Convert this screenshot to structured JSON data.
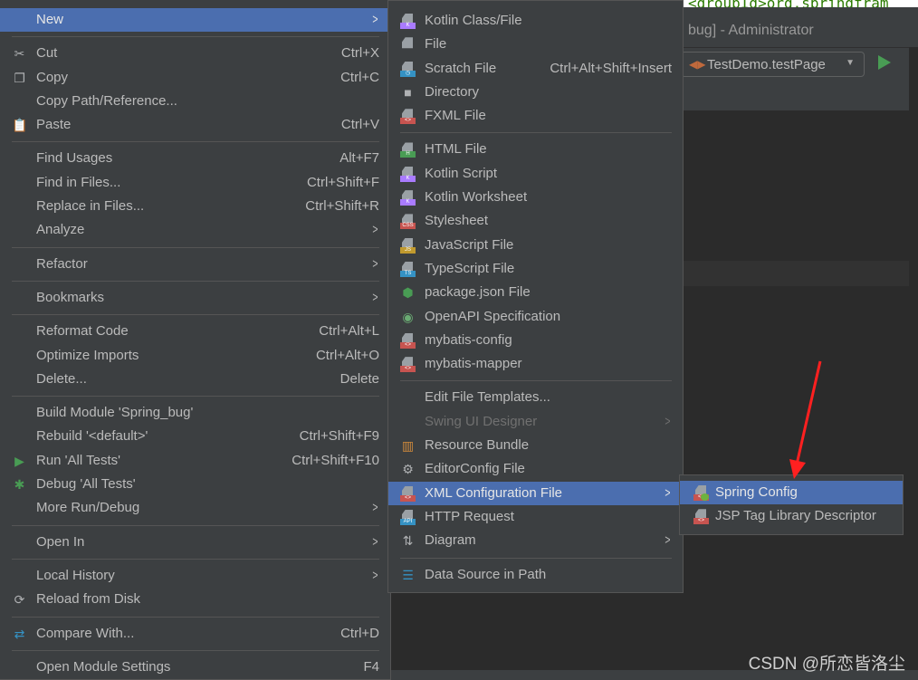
{
  "background": {
    "code_text": "<groupId>org.springfram",
    "window_title": "bug] - Administrator",
    "run_config": "TestDemo.testPage"
  },
  "context_menu": [
    {
      "label": "New",
      "submenu": true,
      "selected": true
    },
    {
      "sep": true
    },
    {
      "label": "Cut",
      "shortcut": "Ctrl+X",
      "icon": "scissors-icon"
    },
    {
      "label": "Copy",
      "shortcut": "Ctrl+C",
      "icon": "copy-icon"
    },
    {
      "label": "Copy Path/Reference..."
    },
    {
      "label": "Paste",
      "shortcut": "Ctrl+V",
      "icon": "clipboard-icon"
    },
    {
      "sep": true
    },
    {
      "label": "Find Usages",
      "shortcut": "Alt+F7"
    },
    {
      "label": "Find in Files...",
      "shortcut": "Ctrl+Shift+F"
    },
    {
      "label": "Replace in Files...",
      "shortcut": "Ctrl+Shift+R"
    },
    {
      "label": "Analyze",
      "submenu": true
    },
    {
      "sep": true
    },
    {
      "label": "Refactor",
      "submenu": true
    },
    {
      "sep": true
    },
    {
      "label": "Bookmarks",
      "submenu": true
    },
    {
      "sep": true
    },
    {
      "label": "Reformat Code",
      "shortcut": "Ctrl+Alt+L"
    },
    {
      "label": "Optimize Imports",
      "shortcut": "Ctrl+Alt+O"
    },
    {
      "label": "Delete...",
      "shortcut": "Delete"
    },
    {
      "sep": true
    },
    {
      "label": "Build Module 'Spring_bug'"
    },
    {
      "label": "Rebuild '<default>'",
      "shortcut": "Ctrl+Shift+F9"
    },
    {
      "label": "Run 'All Tests'",
      "shortcut": "Ctrl+Shift+F10",
      "icon": "run-icon"
    },
    {
      "label": "Debug 'All Tests'",
      "icon": "debug-icon"
    },
    {
      "label": "More Run/Debug",
      "submenu": true
    },
    {
      "sep": true
    },
    {
      "label": "Open In",
      "submenu": true
    },
    {
      "sep": true
    },
    {
      "label": "Local History",
      "submenu": true
    },
    {
      "label": "Reload from Disk",
      "icon": "reload-icon"
    },
    {
      "sep": true
    },
    {
      "label": "Compare With...",
      "shortcut": "Ctrl+D",
      "icon": "compare-icon"
    },
    {
      "sep": true
    },
    {
      "label": "Open Module Settings",
      "shortcut": "F4"
    }
  ],
  "new_menu": [
    {
      "label": "Kotlin Class/File",
      "icon": "kotlin-file-icon",
      "badge": "K",
      "color": "#a97bff"
    },
    {
      "label": "File",
      "icon": "file-icon"
    },
    {
      "label": "Scratch File",
      "shortcut": "Ctrl+Alt+Shift+Insert",
      "icon": "scratch-file-icon",
      "badge": "◷",
      "color": "#3592c4"
    },
    {
      "label": "Directory",
      "icon": "folder-icon"
    },
    {
      "label": "FXML File",
      "icon": "fxml-file-icon",
      "badge": "<>",
      "color": "#c75450"
    },
    {
      "sep": true
    },
    {
      "label": "HTML File",
      "icon": "html-file-icon",
      "badge": "H",
      "color": "#499c54"
    },
    {
      "label": "Kotlin Script",
      "icon": "kotlin-script-icon",
      "badge": "K",
      "color": "#a97bff"
    },
    {
      "label": "Kotlin Worksheet",
      "icon": "kotlin-worksheet-icon",
      "badge": "K",
      "color": "#a97bff"
    },
    {
      "label": "Stylesheet",
      "icon": "css-file-icon",
      "badge": "CSS",
      "color": "#c75450"
    },
    {
      "label": "JavaScript File",
      "icon": "js-file-icon",
      "badge": "JS",
      "color": "#c19a2e"
    },
    {
      "label": "TypeScript File",
      "icon": "ts-file-icon",
      "badge": "TS",
      "color": "#3592c4"
    },
    {
      "label": "package.json File",
      "icon": "nodejs-icon"
    },
    {
      "label": "OpenAPI Specification",
      "icon": "openapi-icon"
    },
    {
      "label": "mybatis-config",
      "icon": "xml-file-icon",
      "badge": "<>",
      "color": "#c75450"
    },
    {
      "label": "mybatis-mapper",
      "icon": "xml-file-icon",
      "badge": "<>",
      "color": "#c75450"
    },
    {
      "sep": true
    },
    {
      "label": "Edit File Templates..."
    },
    {
      "label": "Swing UI Designer",
      "submenu": true,
      "disabled": true
    },
    {
      "label": "Resource Bundle",
      "icon": "resource-bundle-icon"
    },
    {
      "label": "EditorConfig File",
      "icon": "gear-icon"
    },
    {
      "label": "XML Configuration File",
      "submenu": true,
      "selected": true,
      "icon": "xml-file-icon",
      "badge": "<>",
      "color": "#c75450"
    },
    {
      "label": "HTTP Request",
      "icon": "http-request-icon",
      "badge": "API",
      "color": "#3592c4"
    },
    {
      "label": "Diagram",
      "submenu": true,
      "icon": "diagram-icon"
    },
    {
      "sep": true
    },
    {
      "label": "Data Source in Path",
      "icon": "database-icon"
    }
  ],
  "xml_menu": [
    {
      "label": "Spring Config",
      "selected": true,
      "icon": "spring-config-icon",
      "badge": "<>",
      "color": "#c75450"
    },
    {
      "label": "JSP Tag Library Descriptor",
      "icon": "xml-file-icon",
      "badge": "<>",
      "color": "#c75450"
    }
  ],
  "watermark": "CSDN @所恋皆洛尘",
  "colors": {
    "menu_bg": "#3c3f41",
    "selection": "#4b6eaf",
    "annotation_arrow": "#ff2020"
  }
}
